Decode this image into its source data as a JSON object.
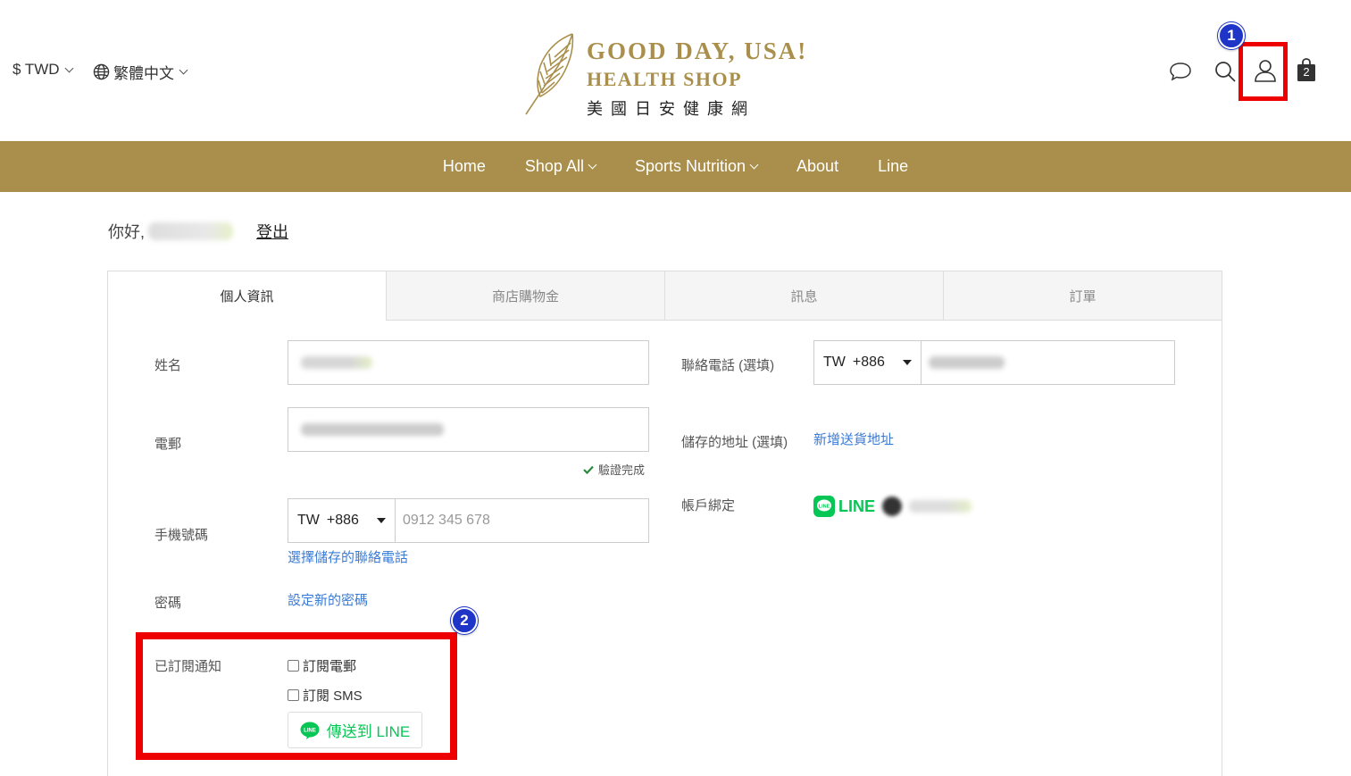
{
  "header": {
    "currency": "$ TWD",
    "language": "繁體中文",
    "logo": {
      "title": "GOOD DAY, USA!",
      "subtitle": "HEALTH SHOP",
      "chinese": "美國日安健康網"
    },
    "cart_count": "2",
    "annotations": {
      "marker_1": "1",
      "marker_2": "2"
    },
    "accent_color": "#a98f4b",
    "highlight_color": "#ee0000"
  },
  "nav": {
    "items": [
      {
        "label": "Home",
        "dropdown": false
      },
      {
        "label": "Shop All",
        "dropdown": true
      },
      {
        "label": "Sports Nutrition",
        "dropdown": true
      },
      {
        "label": "About",
        "dropdown": false
      },
      {
        "label": "Line",
        "dropdown": false
      }
    ]
  },
  "greeting": {
    "prefix": "你好,",
    "logout": "登出"
  },
  "tabs": [
    {
      "label": "個人資訊",
      "active": true
    },
    {
      "label": "商店購物金",
      "active": false
    },
    {
      "label": "訊息",
      "active": false
    },
    {
      "label": "訂單",
      "active": false
    }
  ],
  "form": {
    "name_label": "姓名",
    "email_label": "電郵",
    "email_verified": "驗證完成",
    "mobile_label": "手機號碼",
    "mobile_country": "TW",
    "mobile_code": "+886",
    "mobile_placeholder": "0912 345 678",
    "choose_saved_phone": "選擇儲存的聯絡電話",
    "password_label": "密碼",
    "set_password": "設定新的密碼",
    "subscription_label": "已訂閱通知",
    "subscribe_email": "訂閱電郵",
    "subscribe_sms": "訂閱 SMS",
    "send_line": "傳送到 LINE",
    "contact_phone_label": "聯絡電話 (選填)",
    "contact_country": "TW",
    "contact_code": "+886",
    "saved_address_label": "儲存的地址 (選填)",
    "add_address": "新增送貨地址",
    "account_binding_label": "帳戶綁定",
    "line_brand": "LINE",
    "line_color": "#06c755",
    "link_color": "#3a7bd5"
  }
}
